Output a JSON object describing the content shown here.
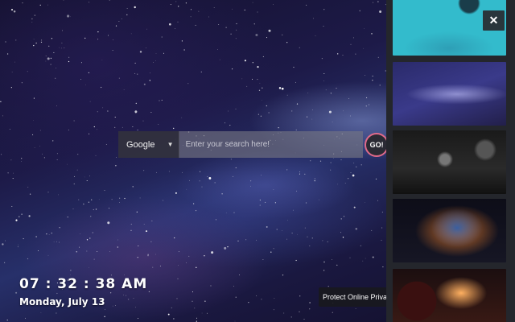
{
  "search": {
    "engine": "Google",
    "placeholder": "Enter your search here!",
    "go_label": "GO!"
  },
  "clock": {
    "time": "07 : 32 : 38 AM",
    "date": "Monday, July 13"
  },
  "toast": {
    "text": "Protect Online Privacy, U"
  },
  "panel": {
    "close_label": "✕",
    "thumbnails": [
      "blue-planet-wallpaper",
      "milky-way-wallpaper",
      "moons-wallpaper",
      "nebula-wallpaper",
      "sun-eclipse-wallpaper"
    ]
  },
  "colors": {
    "go_ring": "#e06a8a",
    "panel_bg": "#24262c"
  }
}
